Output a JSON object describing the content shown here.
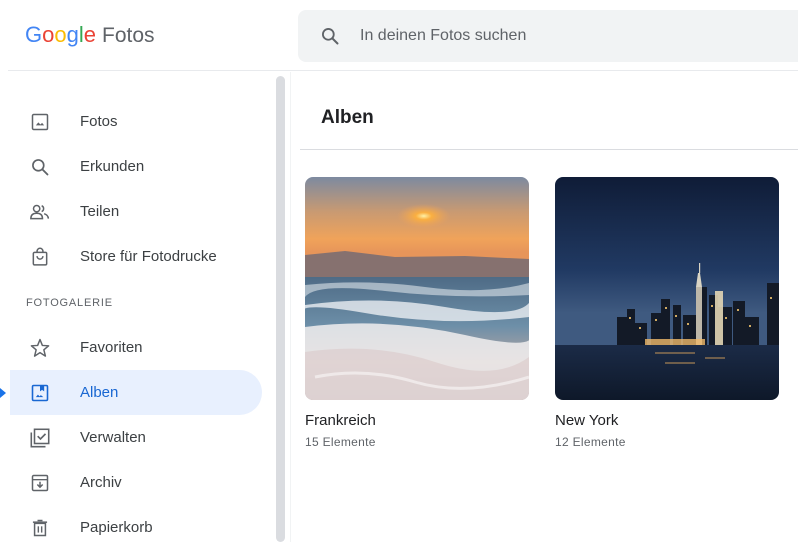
{
  "app": {
    "logo_letters": [
      {
        "char": "G",
        "color": "#4285F4"
      },
      {
        "char": "o",
        "color": "#EA4335"
      },
      {
        "char": "o",
        "color": "#FBBC05"
      },
      {
        "char": "g",
        "color": "#4285F4"
      },
      {
        "char": "l",
        "color": "#34A853"
      },
      {
        "char": "e",
        "color": "#EA4335"
      }
    ],
    "product_name": "Fotos"
  },
  "search": {
    "placeholder": "In deinen Fotos suchen",
    "icon": "search-icon"
  },
  "sidebar": {
    "items": [
      {
        "label": "Fotos",
        "icon": "photo-icon"
      },
      {
        "label": "Erkunden",
        "icon": "search-icon"
      },
      {
        "label": "Teilen",
        "icon": "people-icon"
      },
      {
        "label": "Store für Fotodrucke",
        "icon": "shopping-bag-icon"
      }
    ],
    "section_label": "FOTOGALERIE",
    "library_items": [
      {
        "label": "Favoriten",
        "icon": "star-icon"
      },
      {
        "label": "Alben",
        "icon": "album-icon",
        "active": true
      },
      {
        "label": "Verwalten",
        "icon": "manage-check-icon"
      },
      {
        "label": "Archiv",
        "icon": "archive-icon"
      },
      {
        "label": "Papierkorb",
        "icon": "trash-icon"
      }
    ]
  },
  "main": {
    "title": "Alben",
    "albums": [
      {
        "name": "Frankreich",
        "count": "15 Elemente"
      },
      {
        "name": "New York",
        "count": "12 Elemente"
      }
    ]
  },
  "colors": {
    "accent": "#1a73e8",
    "active_bg": "#e8f0fe",
    "icon_gray": "#5f6368"
  }
}
